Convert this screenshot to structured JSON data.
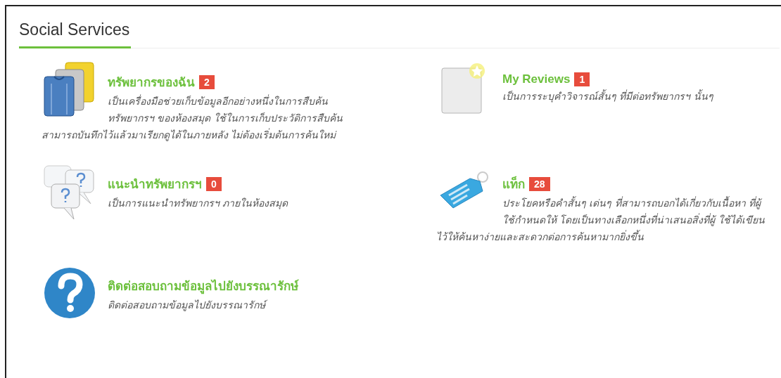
{
  "panel": {
    "title": "Social Services"
  },
  "items": [
    {
      "kind": "shirts",
      "title": "ทรัพยากรของฉัน",
      "badge": "2",
      "description": "เป็นเครื่องมือช่วยเก็บข้อมูลอีกอย่างหนึ่งในการสืบค้น ทรัพยากรฯ ของห้องสมุด ใช้ในการเก็บประวัติการสืบค้น สามารถบันทึกไว้แล้วมาเรียกดูได้ในภายหลัง ไม่ต้องเริ่มต้นการค้นใหม่"
    },
    {
      "kind": "review",
      "title": "My Reviews",
      "badge": "1",
      "description": "เป็นการระบุคำวิจารณ์สั้นๆ ที่มีต่อทรัพยากรฯ นั้นๆ"
    },
    {
      "kind": "questions",
      "title": "แนะนำทรัพยากรฯ",
      "badge": "0",
      "description": "เป็นการแนะนำทรัพยากรฯ ภายในห้องสมุด"
    },
    {
      "kind": "tag",
      "title": "แท็ก",
      "badge": "28",
      "description": "ประโยคหรือคำสั้นๆ เด่นๆ ที่สามารถบอกได้เกี่ยวกับเนื้อหา ที่ผู้ใช้กำหนดให้ โดยเป็นทางเลือกหนึ่งที่น่าเสนอสิ่งที่ผู้ ใช้ได้เขียนไว้ให้ค้นหาง่ายและสะดวกต่อการค้นหามากยิ่งขึ้น"
    },
    {
      "kind": "help",
      "title": "ติดต่อสอบถามข้อมูลไปยังบรรณารักษ์",
      "description": "ติดต่อสอบถามข้อมูลไปยังบรรณารักษ์"
    }
  ]
}
